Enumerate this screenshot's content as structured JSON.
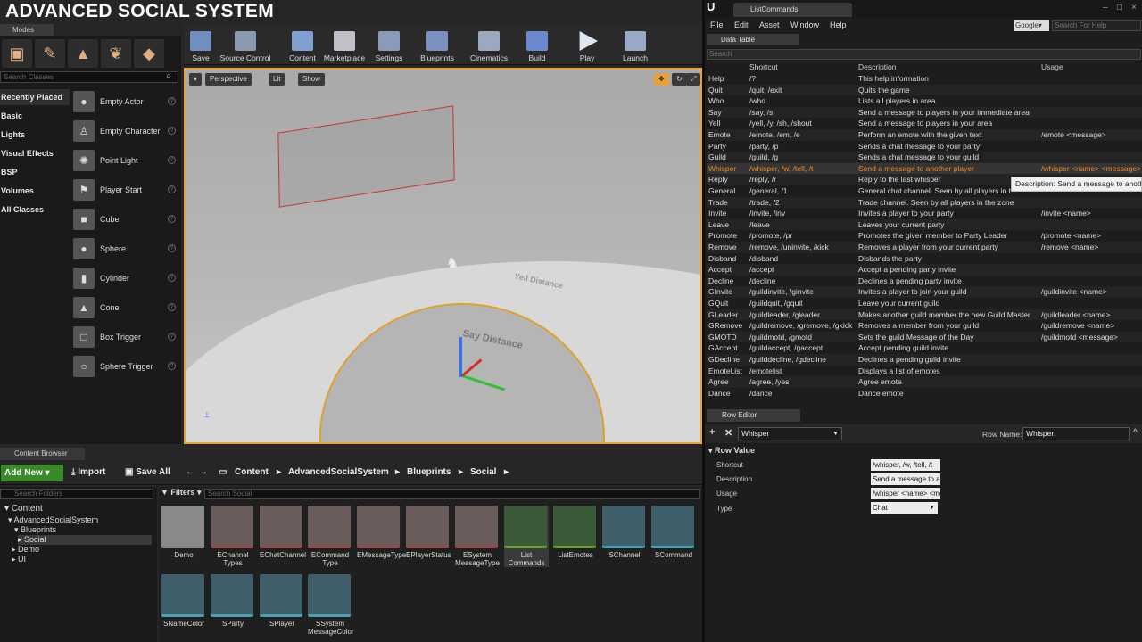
{
  "brand": "ADVANCED SOCIAL SYSTEM",
  "modes": {
    "tab": "Modes",
    "search_placeholder": "Search Classes",
    "categories": [
      "Recently Placed",
      "Basic",
      "Lights",
      "Visual Effects",
      "BSP",
      "Volumes",
      "All Classes"
    ],
    "actors": [
      "Empty Actor",
      "Empty Character",
      "Point Light",
      "Player Start",
      "Cube",
      "Sphere",
      "Cylinder",
      "Cone",
      "Box Trigger",
      "Sphere Trigger"
    ]
  },
  "toolbar": [
    "Save",
    "Source Control",
    "Content",
    "Marketplace",
    "Settings",
    "Blueprints",
    "Cinematics",
    "Build",
    "Play",
    "Launch"
  ],
  "viewport": {
    "perspective": "Perspective",
    "lit": "Lit",
    "show": "Show",
    "yell_label": "Yell Distance",
    "say_label": "Say Distance"
  },
  "content_browser": {
    "tab": "Content Browser",
    "add_new": "Add New",
    "import": "Import",
    "save_all": "Save All",
    "breadcrumb": [
      "Content",
      "AdvancedSocialSystem",
      "Blueprints",
      "Social"
    ],
    "search_folders": "Search Folders",
    "filters": "Filters",
    "search_social": "Search Social",
    "tree": [
      "Content",
      "AdvancedSocialSystem",
      "Blueprints",
      "Social",
      "Demo",
      "UI"
    ],
    "assets": [
      {
        "name": "Demo",
        "kind": "folder"
      },
      {
        "name": "EChannel Types",
        "kind": "doc"
      },
      {
        "name": "EChatChannel",
        "kind": "doc"
      },
      {
        "name": "ECommand Type",
        "kind": "doc"
      },
      {
        "name": "EMessageType",
        "kind": "doc"
      },
      {
        "name": "EPlayerStatus",
        "kind": "doc"
      },
      {
        "name": "ESystem MessageType",
        "kind": "doc"
      },
      {
        "name": "List Commands",
        "kind": "struct"
      },
      {
        "name": "ListEmotes",
        "kind": "struct"
      },
      {
        "name": "SChannel",
        "kind": "enum"
      },
      {
        "name": "SCommand",
        "kind": "enum"
      },
      {
        "name": "SNameColor",
        "kind": "enum"
      },
      {
        "name": "SParty",
        "kind": "enum"
      },
      {
        "name": "SPlayer",
        "kind": "enum"
      },
      {
        "name": "SSystem MessageColor",
        "kind": "enum"
      }
    ]
  },
  "right": {
    "tab": "ListCommands",
    "menu": [
      "File",
      "Edit",
      "Asset",
      "Window",
      "Help"
    ],
    "google": "Google",
    "help_search": "Search For Help",
    "data_table_tab": "Data Table",
    "search": "Search",
    "headers": [
      "Shortcut",
      "Description",
      "Usage"
    ],
    "rows": [
      [
        "Help",
        "/?",
        "This help information",
        ""
      ],
      [
        "Quit",
        "/quit, /exit",
        "Quits the game",
        ""
      ],
      [
        "Who",
        "/who",
        "Lists all players in area",
        ""
      ],
      [
        "Say",
        "/say, /s",
        "Send a message to players in your immediate area",
        ""
      ],
      [
        "Yell",
        "/yell, /y, /sh, /shout",
        "Send a message to players in your area",
        ""
      ],
      [
        "Emote",
        "/emote, /em, /e",
        "Perform an emote with the given text",
        "/emote <message>"
      ],
      [
        "Party",
        "/party, /p",
        "Sends a chat message to your party",
        ""
      ],
      [
        "Guild",
        "/guild, /g",
        "Sends a chat message to your guild",
        ""
      ],
      [
        "Whisper",
        "/whisper, /w, /tell, /t",
        "Send a message to another player",
        "/whisper <name> <message>"
      ],
      [
        "Reply",
        "/reply, /r",
        "Reply to the last whisper",
        ""
      ],
      [
        "General",
        "/general, /1",
        "General chat channel. Seen by all players in t",
        ""
      ],
      [
        "Trade",
        "/trade, /2",
        "Trade channel. Seen by all players in the zone",
        ""
      ],
      [
        "Invite",
        "/invite, /inv",
        "Invites a player to your party",
        "/invite <name>"
      ],
      [
        "Leave",
        "/leave",
        "Leaves your current party",
        ""
      ],
      [
        "Promote",
        "/promote, /pr",
        "Promotes the given member to Party Leader",
        "/promote <name>"
      ],
      [
        "Remove",
        "/remove, /uninvite, /kick",
        "Removes a player from your current party",
        "/remove <name>"
      ],
      [
        "Disband",
        "/disband",
        "Disbands the party",
        ""
      ],
      [
        "Accept",
        "/accept",
        "Accept a pending party invite",
        ""
      ],
      [
        "Decline",
        "/decline",
        "Declines a pending party invite",
        ""
      ],
      [
        "GInvite",
        "/guildinvite, /ginvite",
        "Invites a player to join your guild",
        "/guildinvite <name>"
      ],
      [
        "GQuit",
        "/guildquit, /gquit",
        "Leave your current guild",
        ""
      ],
      [
        "GLeader",
        "/guildleader, /gleader",
        "Makes another guild member the new Guild Master",
        "/guildleader <name>"
      ],
      [
        "GRemove",
        "/guildremove, /gremove, /gkick",
        "Removes a member from your guild",
        "/guildremove <name>"
      ],
      [
        "GMOTD",
        "/guildmotd, /gmotd",
        "Sets the guild Message of the Day",
        "/guildmotd <message>"
      ],
      [
        "GAccept",
        "/guildaccept, /gaccept",
        "Accept pending guild invite",
        ""
      ],
      [
        "GDecline",
        "/guilddecline, /gdecline",
        "Declines a pending guild invite",
        ""
      ],
      [
        "EmoteList",
        "/emotelist",
        "Displays a list of emotes",
        ""
      ],
      [
        "Agree",
        "/agree, /yes",
        "Agree emote",
        ""
      ],
      [
        "Dance",
        "/dance",
        "Dance emote",
        ""
      ]
    ],
    "tooltip": "Description: Send a message to another player",
    "row_editor_tab": "Row Editor",
    "row_select": "Whisper",
    "row_name_label": "Row Name:",
    "row_name": "Whisper",
    "row_value": "Row Value",
    "fields": [
      {
        "label": "Shortcut",
        "value": "/whisper, /w, /tell, /t"
      },
      {
        "label": "Description",
        "value": "Send a message to another player"
      },
      {
        "label": "Usage",
        "value": "/whisper <name> <message>"
      }
    ],
    "type_label": "Type",
    "type_value": "Chat"
  }
}
